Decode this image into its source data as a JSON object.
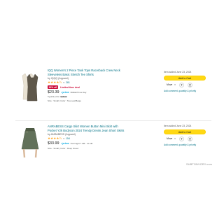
{
  "items": [
    {
      "title": "IQQ Women's 2 Piece Tank Tops Racerback Crew Neck Sleeveless Basic Stretch Tee Shirts",
      "brand": "by IQQQ (Apparel)",
      "stars": "★★★★½",
      "reviews": "281",
      "deal_badge": "19% off",
      "deal_text": "Limited time deal",
      "price": "$23.39",
      "prime": "✓prime",
      "delivery": "FREE Prime Day",
      "typical_label": "Typical price:",
      "typical_price": "$28.99",
      "meta": "Size : Small  |  Color : Tea Leaf,Beige",
      "added": "Item added June 23, 2024",
      "add_to_cart": "Add to Cart",
      "move": "Move",
      "comment": "Add comment, quantity & priority"
    },
    {
      "title": "ANRABESS Cargo Skirt Women Button Mini Skirt with Pocket Y2k Bodycon 2024 Trendy Denim Jean Short Skirts",
      "brand": "by ANRABESS (Apparel)",
      "stars": "★★★★½",
      "reviews": "154",
      "price": "$33.99",
      "prime": "✓prime",
      "delivery": "Overnight 7 AM - 11 AM",
      "meta": "Size : Small  |  Color : Deep Green",
      "added": "Item added June 23, 2024",
      "add_to_cart": "Add to Cart",
      "move": "Move",
      "comment": "Add comment, quantity & priority"
    }
  ],
  "watermark": "SUBTONVORY.com",
  "colors": {
    "link": "#007185",
    "star": "#ffa41c",
    "cart_button": "#ffd814",
    "deal": "#cc0c39",
    "prime": "#00a8e1"
  }
}
